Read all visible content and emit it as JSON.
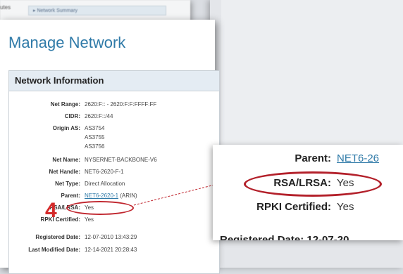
{
  "background_window": {
    "routes_text": "utes",
    "summary_item": "▸ Network Summary"
  },
  "page": {
    "title": "Manage Network",
    "section_title": "Network Information"
  },
  "fields": [
    {
      "label": "Net Range:",
      "value": "2620:F:: - 2620:F:F:FFFF:FF"
    },
    {
      "label": "CIDR:",
      "value": "2620:F::/44"
    },
    {
      "label": "Origin AS:",
      "value": "AS3754"
    },
    {
      "label": "",
      "value": "AS3755"
    },
    {
      "label": "",
      "value": "AS3756"
    },
    {
      "label": "Net Name:",
      "value": "NYSERNET-BACKBONE-V6"
    },
    {
      "label": "Net Handle:",
      "value": "NET6-2620-F-1"
    },
    {
      "label": "Net Type:",
      "value": "Direct Allocation"
    },
    {
      "label": "Parent:",
      "value": "NET6-2620-1",
      "suffix": " (ARIN)"
    },
    {
      "label": "RSA/LRSA:",
      "value": "Yes"
    },
    {
      "label": "RPKI Certified:",
      "value": "Yes"
    },
    {
      "label": "Registered Date:",
      "value": "12-07-2010 13:43:29"
    },
    {
      "label": "Last Modified Date:",
      "value": "12-14-2021 20:28:43"
    }
  ],
  "annotation": {
    "step_number": "4",
    "highlight_color": "#c0262e"
  },
  "zoom": {
    "parent_label": "Parent:",
    "parent_value": "NET6-26",
    "rsa_label": "RSA/LRSA:",
    "rsa_value": "Yes",
    "rpki_label": "RPKI Certified:",
    "rpki_value": "Yes",
    "cut_text": "Registered Date: 12-07-20"
  },
  "colors": {
    "title": "#2f7aa8",
    "link": "#2f7aa8",
    "annotation_red": "#d42a2a"
  }
}
